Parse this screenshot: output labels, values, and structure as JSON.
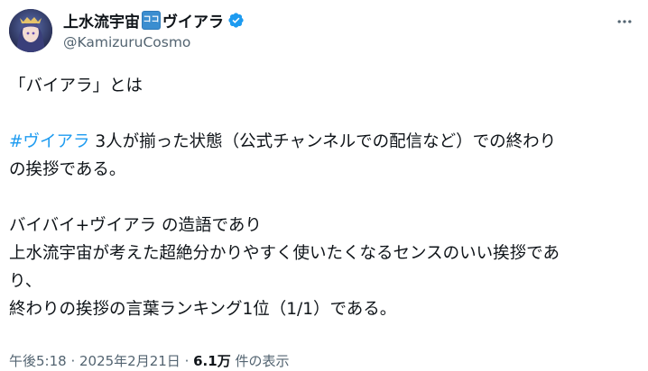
{
  "author": {
    "name": "上水流宇宙",
    "emoji": "ココ",
    "name_suffix": "ヴイアラ",
    "handle": "@KamizuruCosmo"
  },
  "tweet": {
    "line1": "「バイアラ」とは",
    "hashtag": "#ヴイアラ",
    "line3_rest": " 3人が揃った状態（公式チャンネルでの配信など）での終わり",
    "line4": "の挨拶である。",
    "line6": "バイバイ+ヴイアラ の造語であり",
    "line7": "上水流宇宙が考えた超絶分かりやすく使いたくなるセンスのいい挨拶であ",
    "line8": "り、",
    "line9": "終わりの挨拶の言葉ランキング1位（1/1）である。"
  },
  "meta": {
    "time": "午後5:18",
    "sep1": " · ",
    "date": "2025年2月21日",
    "sep2": " · ",
    "views_count": "6.1万",
    "views_label": " 件の表示"
  },
  "colors": {
    "accent": "#1d9bf0",
    "secondary_text": "#536471",
    "verified": "#1d9bf0"
  },
  "icons": {
    "verified": "verified-badge-icon",
    "more": "more-horizontal-icon"
  }
}
